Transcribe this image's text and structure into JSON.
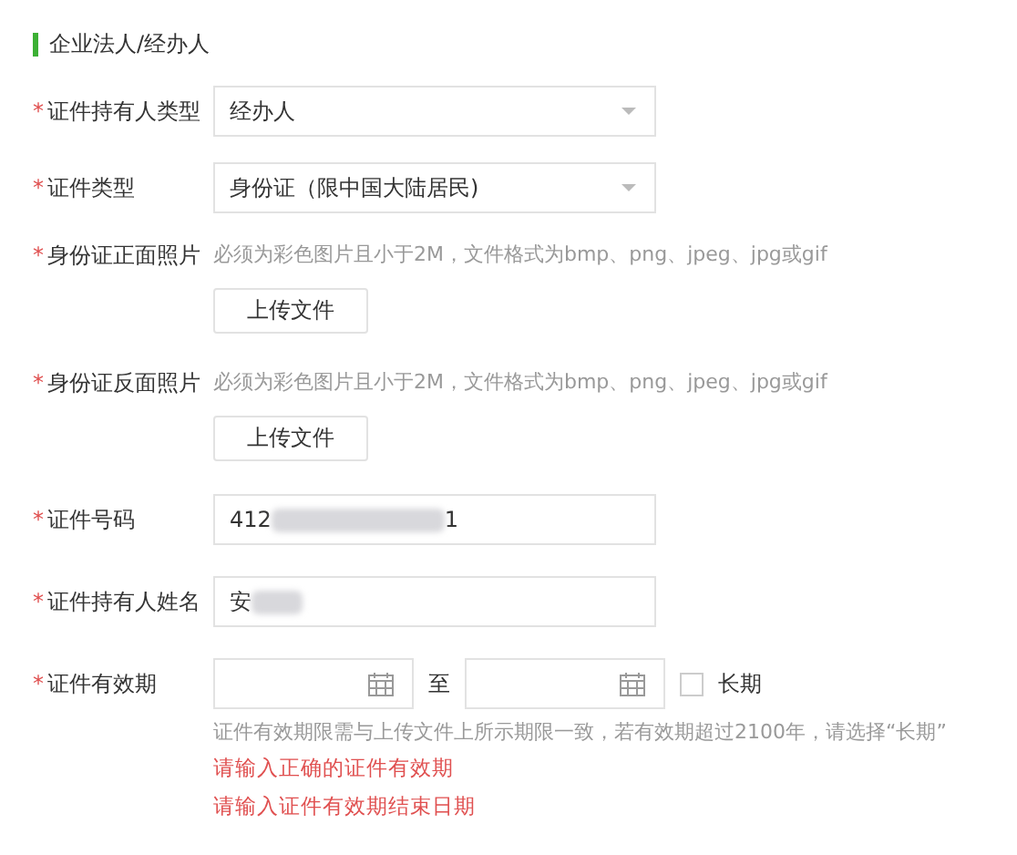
{
  "section": {
    "title": "企业法人/经办人"
  },
  "fields": [
    {
      "kind": "select",
      "marker": "*",
      "label": "证件持有人类型",
      "value": "经办人"
    },
    {
      "kind": "select",
      "marker": "*",
      "label": "证件类型",
      "value": "身份证（限中国大陆居民)"
    },
    {
      "kind": "upload",
      "marker": "*",
      "label": "身份证正面照片",
      "hint": "必须为彩色图片且小于2M，文件格式为bmp、png、jpeg、jpg或gif",
      "button": "上传文件"
    },
    {
      "kind": "upload",
      "marker": "*",
      "label": "身份证反面照片",
      "hint": "必须为彩色图片且小于2M，文件格式为bmp、png、jpeg、jpg或gif",
      "button": "上传文件"
    },
    {
      "kind": "redacted",
      "marker": "*",
      "label": "证件号码",
      "value_start": "412",
      "value_end": "1",
      "blur_wide": true
    },
    {
      "kind": "redacted",
      "marker": "*",
      "label": "证件持有人姓名",
      "value_start": "安",
      "blur_wide": false
    },
    {
      "kind": "daterange",
      "marker": "*",
      "label": "证件有效期",
      "separator": "至",
      "checkbox": {
        "label": "长期",
        "checked": false
      },
      "hint": "证件有效期限需与上传文件上所示期限一致，若有效期超过2100年，请选择“长期”",
      "errors": [
        "请输入正确的证件有效期",
        "请输入证件有效期结束日期"
      ]
    }
  ]
}
